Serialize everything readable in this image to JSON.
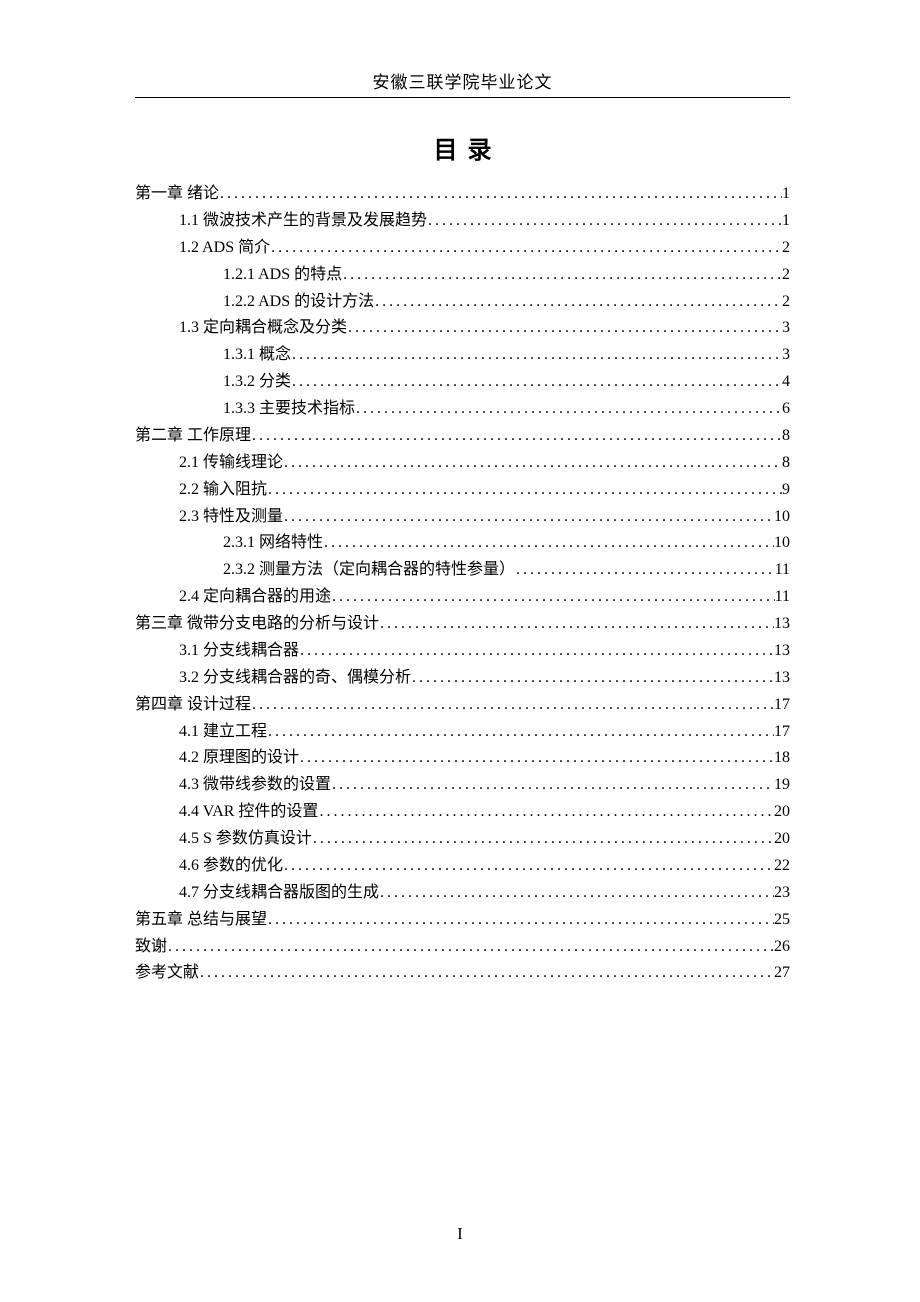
{
  "header": "安徽三联学院毕业论文",
  "title": "目录",
  "footer": "I",
  "toc": [
    {
      "level": 1,
      "label": "第一章  绪论",
      "page": "1"
    },
    {
      "level": 2,
      "label": "1.1  微波技术产生的背景及发展趋势",
      "page": "1"
    },
    {
      "level": 2,
      "label": "1.2  ADS 简介",
      "page": "2"
    },
    {
      "level": 3,
      "label": "1.2.1  ADS 的特点",
      "page": "2"
    },
    {
      "level": 3,
      "label": "1.2.2  ADS 的设计方法",
      "page": "2"
    },
    {
      "level": 2,
      "label": "1.3  定向耦合概念及分类",
      "page": "3"
    },
    {
      "level": 3,
      "label": "1.3.1 概念",
      "page": "3"
    },
    {
      "level": 3,
      "label": "1.3.2 分类",
      "page": "4"
    },
    {
      "level": 3,
      "label": "1.3.3 主要技术指标",
      "page": "6"
    },
    {
      "level": 1,
      "label": "第二章  工作原理",
      "page": "8"
    },
    {
      "level": 2,
      "label": "2.1  传输线理论",
      "page": "8"
    },
    {
      "level": 2,
      "label": "2.2  输入阻抗",
      "page": "9"
    },
    {
      "level": 2,
      "label": "2.3  特性及测量",
      "page": "10"
    },
    {
      "level": 3,
      "label": "2.3.1 网络特性",
      "page": "10"
    },
    {
      "level": 3,
      "label": "2.3.2 测量方法（定向耦合器的特性参量）",
      "page": "11"
    },
    {
      "level": 2,
      "label": "2.4  定向耦合器的用途",
      "page": "11"
    },
    {
      "level": 1,
      "label": "第三章  微带分支电路的分析与设计",
      "page": "13"
    },
    {
      "level": 2,
      "label": "3.1  分支线耦合器",
      "page": "13"
    },
    {
      "level": 2,
      "label": "3.2  分支线耦合器的奇、偶模分析",
      "page": "13"
    },
    {
      "level": 1,
      "label": "第四章  设计过程",
      "page": "17"
    },
    {
      "level": 2,
      "label": "4.1  建立工程",
      "page": "17"
    },
    {
      "level": 2,
      "label": "4.2  原理图的设计",
      "page": "18"
    },
    {
      "level": 2,
      "label": "4.3 微带线参数的设置",
      "page": "19"
    },
    {
      "level": 2,
      "label": "4.4  VAR 控件的设置",
      "page": "20"
    },
    {
      "level": 2,
      "label": "4.5  S 参数仿真设计",
      "page": "20"
    },
    {
      "level": 2,
      "label": "4.6  参数的优化",
      "page": "22"
    },
    {
      "level": 2,
      "label": "4.7 分支线耦合器版图的生成",
      "page": "23"
    },
    {
      "level": 1,
      "label": "第五章  总结与展望",
      "page": "25"
    },
    {
      "level": 1,
      "label": "致谢",
      "page": "26"
    },
    {
      "level": 1,
      "label": "参考文献",
      "page": "27"
    }
  ]
}
